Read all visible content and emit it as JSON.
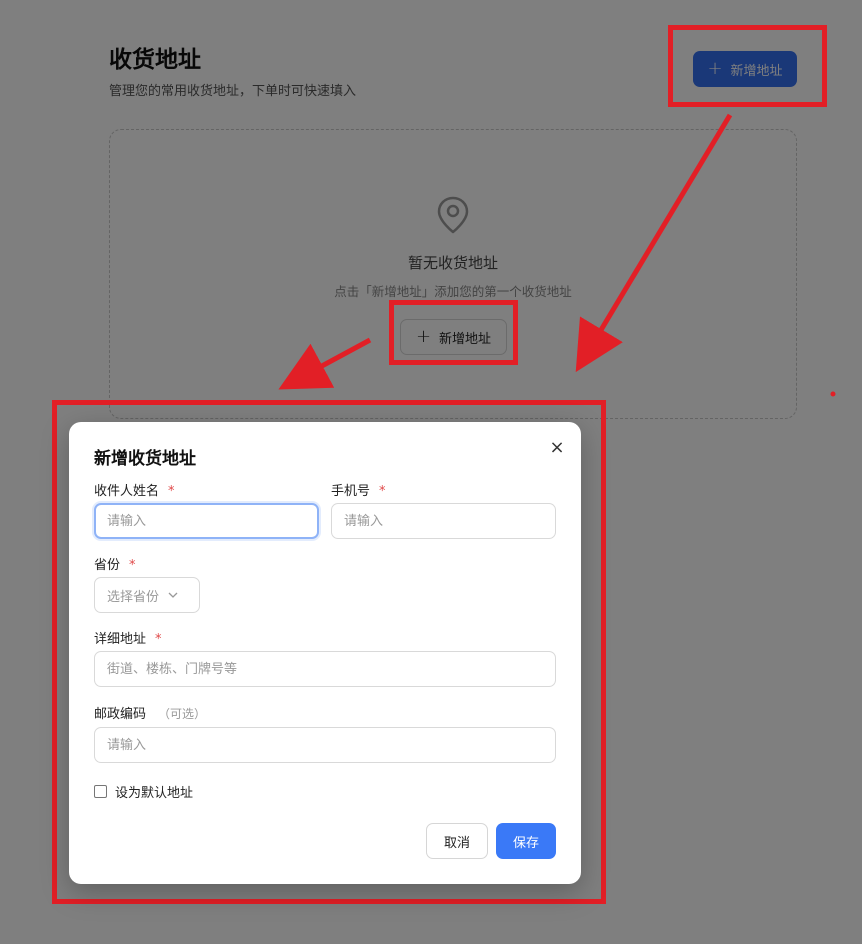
{
  "page": {
    "title": "收货地址",
    "subtitle": "管理您的常用收货地址，下单时可快速填入",
    "add_button_label": "新增地址",
    "plus_glyph": "+",
    "empty_state": {
      "icon": "location-pin-icon",
      "title": "暂无收货地址",
      "description": "点击「新增地址」添加您的第一个收货地址",
      "button_label": "新增地址"
    }
  },
  "modal": {
    "title": "新增收货地址",
    "close_glyph": "×",
    "required_mark": "*",
    "fields": {
      "name": {
        "label": "收件人姓名",
        "placeholder": "请输入",
        "value": ""
      },
      "phone": {
        "label": "手机号",
        "placeholder": "请输入",
        "value": ""
      },
      "province": {
        "label": "省份",
        "placeholder": "选择省份"
      },
      "address": {
        "label": "详细地址",
        "placeholder": "街道、楼栋、门牌号等",
        "value": ""
      },
      "postcode": {
        "label": "邮政编码",
        "optional_note": "（可选）",
        "placeholder": "请输入",
        "value": ""
      }
    },
    "default_checkbox_label": "设为默认地址",
    "cancel_label": "取消",
    "save_label": "保存"
  },
  "colors": {
    "primary": "#3a79f7",
    "required": "#e04848",
    "annotation": "#e21f26",
    "overlay": "rgba(0,0,0,0.5)"
  }
}
